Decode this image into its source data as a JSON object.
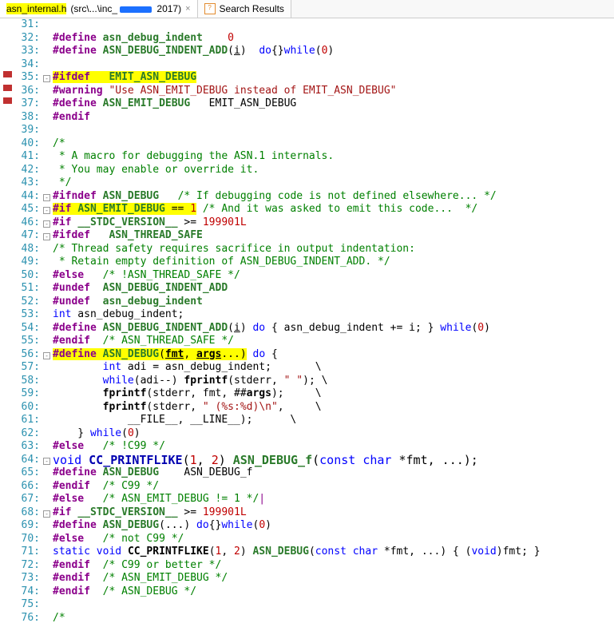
{
  "tabs": [
    {
      "filename": "asn_internal.h",
      "path_prefix": "src\\...\\inc_",
      "path_suffix": " 2017",
      "hl": true,
      "redact": true
    },
    {
      "filename": "Search Results",
      "icon": "search"
    }
  ],
  "lines": [
    {
      "n": 31,
      "s": [
        [
          " ",
          ""
        ]
      ]
    },
    {
      "n": 32,
      "s": [
        [
          "#define ",
          "pp"
        ],
        [
          "asn_debug_indent",
          "mac"
        ],
        [
          "    ",
          ""
        ],
        [
          "0",
          "num"
        ]
      ]
    },
    {
      "n": 33,
      "s": [
        [
          "#define ",
          "pp"
        ],
        [
          "ASN_DEBUG_INDENT_ADD",
          "mac"
        ],
        [
          "(",
          ""
        ],
        [
          "i",
          "u"
        ],
        [
          ")  ",
          ""
        ],
        [
          "do",
          "kw"
        ],
        [
          "{}",
          ""
        ],
        [
          "while",
          "kw"
        ],
        [
          "(",
          ""
        ],
        [
          "0",
          "num"
        ],
        [
          ")",
          ""
        ]
      ]
    },
    {
      "n": 34,
      "s": [
        [
          " ",
          ""
        ]
      ]
    },
    {
      "n": 35,
      "f": "m",
      "red": true,
      "s": [
        [
          "#ifdef   ",
          "pp hl"
        ],
        [
          "EMIT_ASN_DEBUG",
          "mac hl"
        ]
      ]
    },
    {
      "n": 36,
      "red": true,
      "s": [
        [
          "#warning ",
          "pp"
        ],
        [
          "\"Use ASN_EMIT_DEBUG instead of EMIT_ASN_DEBUG\"",
          "str"
        ]
      ]
    },
    {
      "n": 37,
      "red": true,
      "s": [
        [
          "#define ",
          "pp"
        ],
        [
          "ASN_EMIT_DEBUG",
          "mac"
        ],
        [
          "   EMIT_ASN_DEBUG",
          ""
        ]
      ]
    },
    {
      "n": 38,
      "s": [
        [
          "#endif",
          "pp"
        ]
      ]
    },
    {
      "n": 39,
      "s": [
        [
          " ",
          ""
        ]
      ]
    },
    {
      "n": 40,
      "s": [
        [
          "/*",
          "cm"
        ]
      ]
    },
    {
      "n": 41,
      "s": [
        [
          " * A macro for debugging the ASN.1 internals.",
          "cm"
        ]
      ]
    },
    {
      "n": 42,
      "s": [
        [
          " * You may enable or override it.",
          "cm"
        ]
      ]
    },
    {
      "n": 43,
      "s": [
        [
          " */",
          "cm"
        ]
      ]
    },
    {
      "n": 44,
      "f": "m",
      "s": [
        [
          "#ifndef ",
          "pp"
        ],
        [
          "ASN_DEBUG",
          "mac"
        ],
        [
          "   ",
          ""
        ],
        [
          "/* If debugging code is not defined elsewhere... */",
          "cm"
        ]
      ]
    },
    {
      "n": 45,
      "f": "m",
      "s": [
        [
          "#if ",
          "pp hl"
        ],
        [
          "ASN_EMIT_DEBUG",
          "mac hl"
        ],
        [
          " == ",
          "hl"
        ],
        [
          "1",
          "num hl"
        ],
        [
          " ",
          ""
        ],
        [
          "/* And it was asked to emit this code...  */",
          "cm"
        ]
      ]
    },
    {
      "n": 46,
      "f": "m",
      "s": [
        [
          "#if ",
          "pp"
        ],
        [
          "__STDC_VERSION__",
          "mac"
        ],
        [
          " >= ",
          ""
        ],
        [
          "199901L",
          "num"
        ]
      ]
    },
    {
      "n": 47,
      "f": "m",
      "s": [
        [
          "#ifdef   ",
          "pp"
        ],
        [
          "ASN_THREAD_SAFE",
          "mac"
        ]
      ]
    },
    {
      "n": 48,
      "s": [
        [
          "/* Thread safety requires sacrifice in output indentation:",
          "cm"
        ]
      ]
    },
    {
      "n": 49,
      "s": [
        [
          " * Retain empty definition of ASN_DEBUG_INDENT_ADD. */",
          "cm"
        ]
      ]
    },
    {
      "n": 50,
      "s": [
        [
          "#else   ",
          "pp"
        ],
        [
          "/* !ASN_THREAD_SAFE */",
          "cm"
        ]
      ]
    },
    {
      "n": 51,
      "s": [
        [
          "#undef  ",
          "pp"
        ],
        [
          "ASN_DEBUG_INDENT_ADD",
          "mac"
        ]
      ]
    },
    {
      "n": 52,
      "s": [
        [
          "#undef  ",
          "pp"
        ],
        [
          "asn_debug_indent",
          "mac"
        ]
      ]
    },
    {
      "n": 53,
      "s": [
        [
          "int",
          "ty"
        ],
        [
          " asn_debug_indent;",
          ""
        ]
      ]
    },
    {
      "n": 54,
      "s": [
        [
          "#define ",
          "pp"
        ],
        [
          "ASN_DEBUG_INDENT_ADD",
          "mac"
        ],
        [
          "(",
          ""
        ],
        [
          "i",
          "u"
        ],
        [
          ") ",
          ""
        ],
        [
          "do",
          "kw"
        ],
        [
          " { asn_debug_indent += i; } ",
          ""
        ],
        [
          "while",
          "kw"
        ],
        [
          "(",
          ""
        ],
        [
          "0",
          "num"
        ],
        [
          ")",
          ""
        ]
      ]
    },
    {
      "n": 55,
      "s": [
        [
          "#endif  ",
          "pp"
        ],
        [
          "/* ASN_THREAD_SAFE */",
          "cm"
        ]
      ]
    },
    {
      "n": 56,
      "f": "m",
      "s": [
        [
          "#define ",
          "pp hl"
        ],
        [
          "ASN_DEBUG",
          "mac hl"
        ],
        [
          "(",
          "hl"
        ],
        [
          "fmt",
          "fn2 u hl"
        ],
        [
          ", ",
          "hl"
        ],
        [
          "args",
          "fn2 u hl"
        ],
        [
          "...)",
          "hl"
        ],
        [
          " ",
          ""
        ],
        [
          "do",
          "kw"
        ],
        [
          " {",
          ""
        ]
      ]
    },
    {
      "n": 57,
      "s": [
        [
          "        ",
          ""
        ],
        [
          "int",
          "ty"
        ],
        [
          " adi = asn_debug_indent;       \\",
          ""
        ]
      ]
    },
    {
      "n": 58,
      "s": [
        [
          "        ",
          ""
        ],
        [
          "while",
          "kw"
        ],
        [
          "(adi--) ",
          ""
        ],
        [
          "fprintf",
          "fn2"
        ],
        [
          "(stderr, ",
          ""
        ],
        [
          "\" \"",
          "str"
        ],
        [
          "); \\",
          ""
        ]
      ]
    },
    {
      "n": 59,
      "s": [
        [
          "        ",
          ""
        ],
        [
          "fprintf",
          "fn2"
        ],
        [
          "(stderr, fmt, ##",
          ""
        ],
        [
          "args",
          "fn2"
        ],
        [
          ");     \\",
          ""
        ]
      ]
    },
    {
      "n": 60,
      "s": [
        [
          "        ",
          ""
        ],
        [
          "fprintf",
          "fn2"
        ],
        [
          "(stderr, ",
          ""
        ],
        [
          "\" (%s:%d)\\n\"",
          "str"
        ],
        [
          ",     \\",
          ""
        ]
      ]
    },
    {
      "n": 61,
      "s": [
        [
          "            __FILE__, __LINE__);      \\",
          ""
        ]
      ]
    },
    {
      "n": 62,
      "s": [
        [
          "    } ",
          ""
        ],
        [
          "while",
          "kw"
        ],
        [
          "(",
          ""
        ],
        [
          "0",
          "num"
        ],
        [
          ")",
          ""
        ]
      ]
    },
    {
      "n": 63,
      "s": [
        [
          "#else   ",
          "pp"
        ],
        [
          "/* !C99 */",
          "cm"
        ]
      ]
    },
    {
      "n": 64,
      "f": "m",
      "cls": "r64",
      "s": [
        [
          "void",
          "ty"
        ],
        [
          " ",
          ""
        ],
        [
          "CC_PRINTFLIKE",
          "fnb"
        ],
        [
          "(",
          ""
        ],
        [
          "1",
          "num"
        ],
        [
          ", ",
          ""
        ],
        [
          "2",
          "num"
        ],
        [
          ") ",
          ""
        ],
        [
          "ASN_DEBUG_f",
          "mac"
        ],
        [
          "(",
          ""
        ],
        [
          "const",
          "kw"
        ],
        [
          " ",
          ""
        ],
        [
          "char",
          "ty"
        ],
        [
          " *fmt, ...);",
          ""
        ]
      ]
    },
    {
      "n": 65,
      "s": [
        [
          "#define ",
          "pp"
        ],
        [
          "ASN_DEBUG",
          "mac"
        ],
        [
          "    ASN_DEBUG_f",
          ""
        ]
      ]
    },
    {
      "n": 66,
      "s": [
        [
          "#endif  ",
          "pp"
        ],
        [
          "/* C99 */",
          "cm"
        ]
      ]
    },
    {
      "n": 67,
      "s": [
        [
          "#else   ",
          "pp"
        ],
        [
          "/* ASN_EMIT_DEBUG != 1 */",
          "cm"
        ],
        [
          "|",
          "cur"
        ]
      ]
    },
    {
      "n": 68,
      "f": "m",
      "s": [
        [
          "#if ",
          "pp"
        ],
        [
          "__STDC_VERSION__",
          "mac"
        ],
        [
          " >= ",
          ""
        ],
        [
          "199901L",
          "num"
        ]
      ]
    },
    {
      "n": 69,
      "s": [
        [
          "#define ",
          "pp"
        ],
        [
          "ASN_DEBUG",
          "mac"
        ],
        [
          "(...) ",
          ""
        ],
        [
          "do",
          "kw"
        ],
        [
          "{}",
          ""
        ],
        [
          "while",
          "kw"
        ],
        [
          "(",
          ""
        ],
        [
          "0",
          "num"
        ],
        [
          ")",
          ""
        ]
      ]
    },
    {
      "n": 70,
      "s": [
        [
          "#else   ",
          "pp"
        ],
        [
          "/* not C99 */",
          "cm"
        ]
      ]
    },
    {
      "n": 71,
      "s": [
        [
          "static",
          "kw"
        ],
        [
          " ",
          ""
        ],
        [
          "void",
          "ty"
        ],
        [
          " ",
          ""
        ],
        [
          "CC_PRINTFLIKE",
          "fn2"
        ],
        [
          "(",
          ""
        ],
        [
          "1",
          "num"
        ],
        [
          ", ",
          ""
        ],
        [
          "2",
          "num"
        ],
        [
          ") ",
          ""
        ],
        [
          "ASN_DEBUG",
          "mac"
        ],
        [
          "(",
          ""
        ],
        [
          "const",
          "kw"
        ],
        [
          " ",
          ""
        ],
        [
          "char",
          "ty"
        ],
        [
          " *fmt, ...) { (",
          ""
        ],
        [
          "void",
          "ty"
        ],
        [
          ")fmt; }",
          ""
        ]
      ]
    },
    {
      "n": 72,
      "s": [
        [
          "#endif  ",
          "pp"
        ],
        [
          "/* C99 or better */",
          "cm"
        ]
      ]
    },
    {
      "n": 73,
      "s": [
        [
          "#endif  ",
          "pp"
        ],
        [
          "/* ASN_EMIT_DEBUG */",
          "cm"
        ]
      ]
    },
    {
      "n": 74,
      "s": [
        [
          "#endif  ",
          "pp"
        ],
        [
          "/* ASN_DEBUG */",
          "cm"
        ]
      ]
    },
    {
      "n": 75,
      "s": [
        [
          " ",
          ""
        ]
      ]
    },
    {
      "n": 76,
      "s": [
        [
          "/*",
          "cm"
        ]
      ]
    }
  ]
}
